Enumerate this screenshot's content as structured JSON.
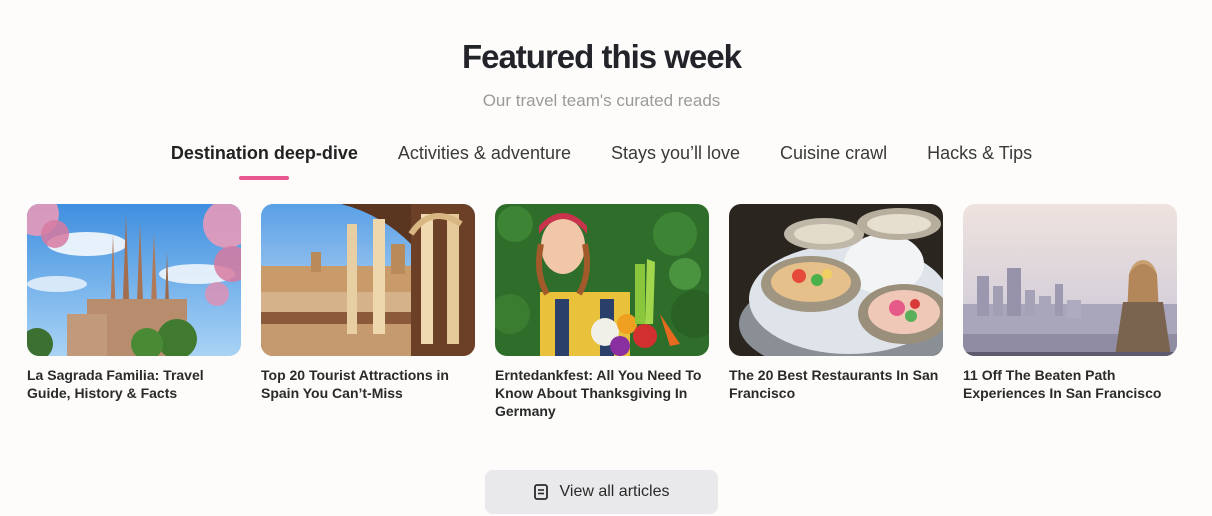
{
  "header": {
    "title": "Featured this week",
    "subtitle": "Our travel team's curated reads"
  },
  "tabs": [
    {
      "label": "Destination deep-dive",
      "active": true
    },
    {
      "label": "Activities & adventure",
      "active": false
    },
    {
      "label": "Stays you’ll love",
      "active": false
    },
    {
      "label": "Cuisine crawl",
      "active": false
    },
    {
      "label": "Hacks & Tips",
      "active": false
    }
  ],
  "articles": [
    {
      "title": "La Sagrada Familia: Travel Guide, History & Facts",
      "image": "sagrada-familia-photo"
    },
    {
      "title": "Top 20 Tourist Attractions in Spain You Can’t-Miss",
      "image": "plaza-de-espana-photo"
    },
    {
      "title": "Erntedankfest: All You Need To Know About Thanksgiving In Germany",
      "image": "harvest-woman-photo"
    },
    {
      "title": "The 20 Best Restaurants In San Francisco",
      "image": "oysters-photo"
    },
    {
      "title": "11 Off The Beaten Path Experiences In San Francisco",
      "image": "san-francisco-view-photo"
    }
  ],
  "view_all": {
    "label": "View all articles",
    "icon": "document-icon"
  },
  "colors": {
    "accent": "#e8578f",
    "button_bg": "#e9e9ec",
    "subtitle": "#9a9a9a"
  }
}
